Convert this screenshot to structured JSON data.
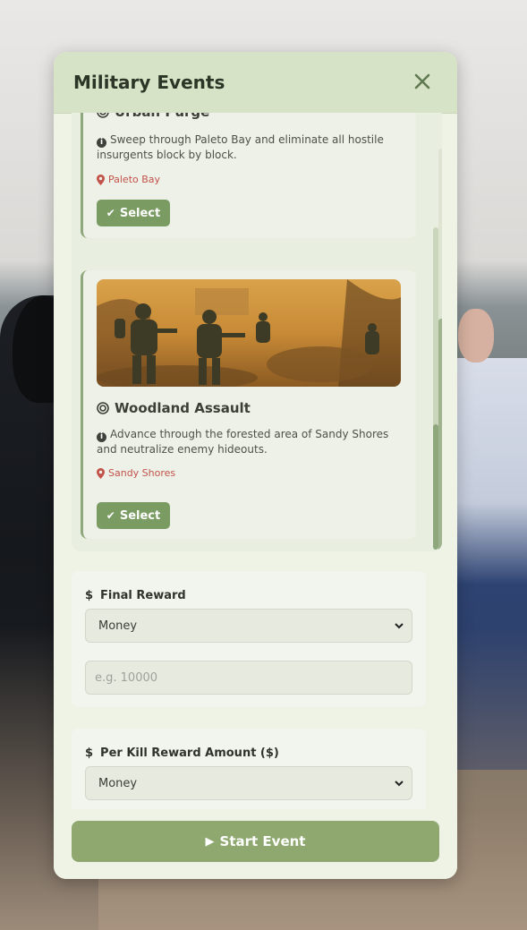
{
  "panel": {
    "title": "Military Events",
    "close_icon": "close-icon"
  },
  "events": [
    {
      "name": "Urban Purge",
      "description": "Sweep through Paleto Bay and eliminate all hostile insurgents block by block.",
      "location": "Paleto Bay",
      "select_label": "Select"
    },
    {
      "name": "Woodland Assault",
      "description": "Advance through the forested area of Sandy Shores and neutralize enemy hideouts.",
      "location": "Sandy Shores",
      "select_label": "Select"
    }
  ],
  "final_reward": {
    "label": "Final Reward",
    "type_value": "Money",
    "amount_placeholder": "e.g. 10000"
  },
  "per_kill_reward": {
    "label": "Per Kill Reward Amount ($)",
    "type_value": "Money"
  },
  "footer": {
    "start_label": "Start Event"
  },
  "colors": {
    "accent": "#7a9b62",
    "header_bg": "#d7e3c7",
    "panel_bg": "#eef3e6",
    "location_text": "#c2524a"
  }
}
